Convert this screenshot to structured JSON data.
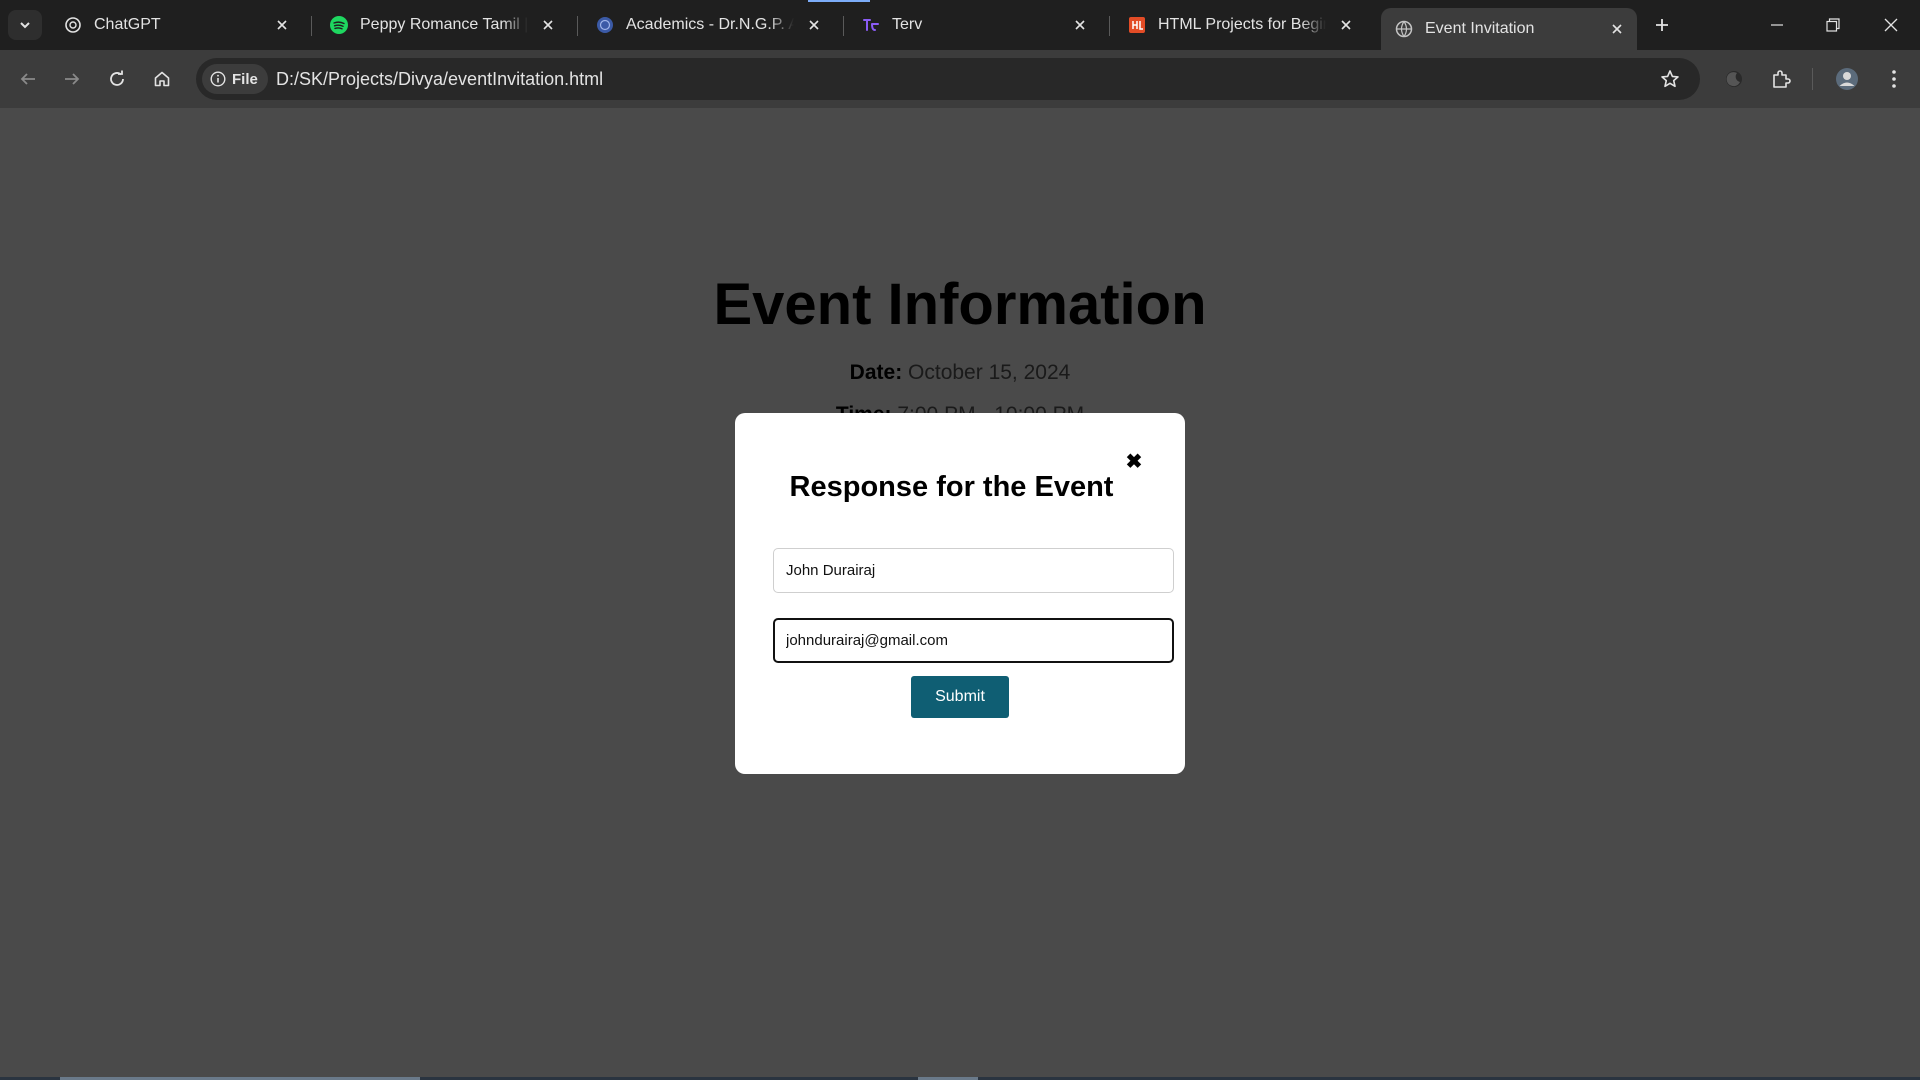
{
  "browser": {
    "tabs": [
      {
        "title": "ChatGPT",
        "icon": "chatgpt-icon"
      },
      {
        "title": "Peppy Romance Tamil | Spotify",
        "icon": "spotify-icon"
      },
      {
        "title": "Academics - Dr.N.G.P. Arts",
        "icon": "college-icon"
      },
      {
        "title": "Terv",
        "icon": "terv-icon"
      },
      {
        "title": "HTML Projects for Beginners",
        "icon": "html-projects-icon"
      },
      {
        "title": "Event Invitation",
        "icon": "globe-icon",
        "active": true
      }
    ],
    "security_chip": "File",
    "url": "D:/SK/Projects/Divya/eventInvitation.html"
  },
  "page": {
    "title": "Event Information",
    "date_label": "Date:",
    "date_value": "October 15, 2024",
    "time_label": "Time:",
    "time_value": "7:00 PM - 10:00 PM"
  },
  "modal": {
    "title": "Response for the Event",
    "close_symbol": "✖",
    "name_value": "John Durairaj",
    "email_value": "johndurairaj@gmail.com",
    "submit_label": "Submit"
  },
  "colors": {
    "page_background": "#4a4a4a",
    "submit_button": "#0f5e73",
    "tab_strip": "#1f1f1f",
    "toolbar": "#3c3c3c"
  }
}
